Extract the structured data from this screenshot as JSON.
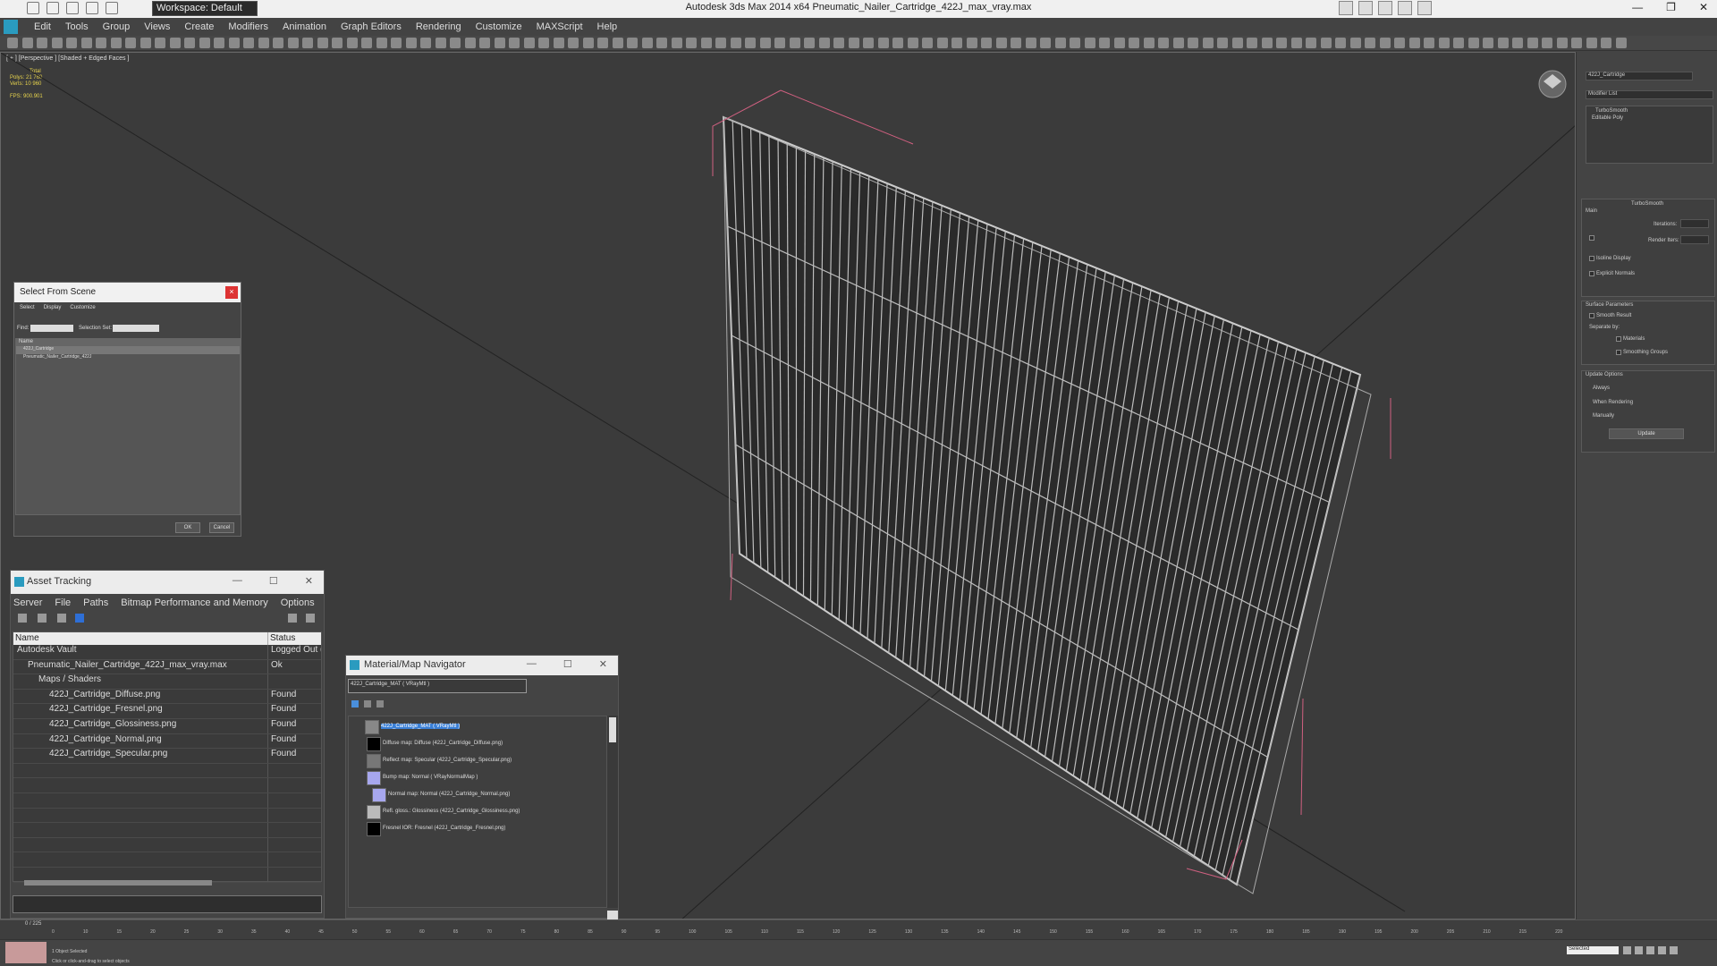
{
  "app": {
    "title": "Autodesk 3ds Max  2014 x64    Pneumatic_Nailer_Cartridge_422J_max_vray.max",
    "workspace": "Workspace: Default"
  },
  "menu": [
    "Edit",
    "Tools",
    "Group",
    "Views",
    "Create",
    "Modifiers",
    "Animation",
    "Graph Editors",
    "Rendering",
    "Customize",
    "MAXScript",
    "Help"
  ],
  "viewport": {
    "label": "[ + ] [Perspective ] [Shaded + Edged Faces ]",
    "stats": {
      "total_label": "Total",
      "polys_label": "Polys:",
      "polys_value": "21 760",
      "verts_label": "Verts:",
      "verts_value": "10 960",
      "fps_label": "FPS:",
      "fps_value": "900.901"
    }
  },
  "command_panel": {
    "object_name": "422J_Cartridge",
    "modifier_list": "Modifier List",
    "stack": [
      "TurboSmooth",
      "Editable Poly"
    ],
    "turbosmooth_title": "TurboSmooth",
    "main_label": "Main",
    "iterations_label": "Iterations:",
    "render_iters_label": "Render Iters:",
    "isoline_label": "Isoline Display",
    "explicit_normals_label": "Explicit Normals",
    "surface_params_label": "Surface Parameters",
    "smooth_result_label": "Smooth Result",
    "separate_by_label": "Separate by:",
    "materials_label": "Materials",
    "smoothing_groups_label": "Smoothing Groups",
    "update_options_label": "Update Options",
    "always_label": "Always",
    "when_rendering_label": "When Rendering",
    "manually_label": "Manually",
    "update_button": "Update"
  },
  "select_from_scene": {
    "title": "Select From Scene",
    "close": "×",
    "tabs": [
      "Select",
      "Display",
      "Customize"
    ],
    "find_label": "Find:",
    "selection_set_label": "Selection Set:",
    "column_name": "Name",
    "items": [
      "422J_Cartridge",
      "Pneumatic_Nailer_Cartridge_422J"
    ],
    "ok": "OK",
    "cancel": "Cancel"
  },
  "asset_tracking": {
    "title": "Asset Tracking",
    "menu": [
      "Server",
      "File",
      "Paths",
      "Bitmap Performance and Memory",
      "Options"
    ],
    "col_name": "Name",
    "col_status": "Status",
    "rows": [
      {
        "name": "Autodesk Vault",
        "status": "Logged Out (",
        "indent": 0
      },
      {
        "name": "Pneumatic_Nailer_Cartridge_422J_max_vray.max",
        "status": "Ok",
        "indent": 1
      },
      {
        "name": "Maps / Shaders",
        "status": "",
        "indent": 2
      },
      {
        "name": "422J_Cartridge_Diffuse.png",
        "status": "Found",
        "indent": 3
      },
      {
        "name": "422J_Cartridge_Fresnel.png",
        "status": "Found",
        "indent": 3
      },
      {
        "name": "422J_Cartridge_Glossiness.png",
        "status": "Found",
        "indent": 3
      },
      {
        "name": "422J_Cartridge_Normal.png",
        "status": "Found",
        "indent": 3
      },
      {
        "name": "422J_Cartridge_Specular.png",
        "status": "Found",
        "indent": 3
      }
    ]
  },
  "material_navigator": {
    "title": "Material/Map Navigator",
    "current": "422J_Cartridge_MAT  ( VRayMtl )",
    "nodes": [
      {
        "label": "422J_Cartridge_MAT  ( VRayMtl )",
        "selected": true,
        "color": "#888888"
      },
      {
        "label": "Diffuse map: Diffuse (422J_Cartridge_Diffuse.png)",
        "selected": false,
        "color": "#000000"
      },
      {
        "label": "Reflect map: Specular (422J_Cartridge_Specular.png)",
        "selected": false,
        "color": "#777777"
      },
      {
        "label": "Bump map: Normal  ( VRayNormalMap )",
        "selected": false,
        "color": "#a7a7ee"
      },
      {
        "label": "Normal map: Normal (422J_Cartridge_Normal.png)",
        "selected": false,
        "color": "#a7a7ee"
      },
      {
        "label": "Refl. gloss.: Glossiness (422J_Cartridge_Glossiness.png)",
        "selected": false,
        "color": "#bbbbbb"
      },
      {
        "label": "Fresnel IOR: Fresnel (422J_Cartridge_Fresnel.png)",
        "selected": false,
        "color": "#000000"
      }
    ]
  },
  "timeline": {
    "frame": "0 / 225",
    "ticks": [
      "0",
      "10",
      "15",
      "20",
      "25",
      "30",
      "35",
      "40",
      "45",
      "50",
      "55",
      "60",
      "65",
      "70",
      "75",
      "80",
      "85",
      "90",
      "95",
      "100",
      "105",
      "110",
      "115",
      "120",
      "125",
      "130",
      "135",
      "140",
      "145",
      "150",
      "155",
      "160",
      "165",
      "170",
      "175",
      "180",
      "185",
      "190",
      "195",
      "200",
      "205",
      "210",
      "215",
      "220"
    ]
  },
  "status": {
    "objects_selected": "1 Object Selected",
    "prompt": "Click or click-and-drag to select objects",
    "selected_dropdown": "Selected"
  }
}
